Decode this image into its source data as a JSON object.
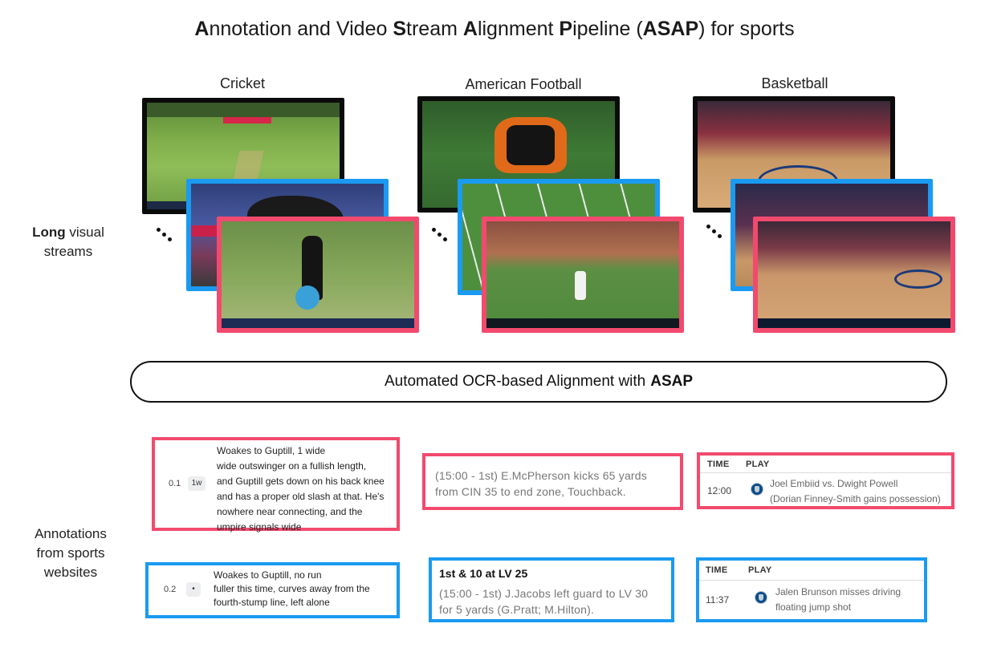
{
  "title": {
    "parts": [
      {
        "text": "A",
        "bold": true
      },
      {
        "text": "nnotation and Video ",
        "bold": false
      },
      {
        "text": "S",
        "bold": true
      },
      {
        "text": "tream ",
        "bold": false
      },
      {
        "text": "A",
        "bold": true
      },
      {
        "text": "lignment ",
        "bold": false
      },
      {
        "text": "P",
        "bold": true
      },
      {
        "text": "ipeline (",
        "bold": false
      },
      {
        "text": "ASAP",
        "bold": true
      },
      {
        "text": ") for sports",
        "bold": false
      }
    ]
  },
  "sports": {
    "cricket": "Cricket",
    "football": "American Football",
    "basketball": "Basketball"
  },
  "side_labels": {
    "streams_bold": "Long",
    "streams_line1_rest": " visual",
    "streams_line2": "streams",
    "annotations_line1": "Annotations",
    "annotations_line2": "from sports",
    "annotations_line3": "websites"
  },
  "banner": {
    "prefix": "Automated OCR-based Alignment with",
    "bold": "ASAP"
  },
  "colors": {
    "pink": "#f24a6e",
    "blue": "#1a9af0",
    "black": "#0b0b0b"
  },
  "annotations": {
    "cricket_pink": {
      "over": "0.1",
      "badge": "1w",
      "lines": [
        "Woakes to Guptill, 1 wide",
        "wide outswinger on a fullish length,",
        "and Guptill gets down on his back knee",
        "and has a proper old slash at that. He's",
        "nowhere near connecting, and the",
        "umpire signals wide"
      ]
    },
    "cricket_blue": {
      "over": "0.2",
      "badge": "•",
      "lines": [
        "Woakes to Guptill, no run",
        "fuller this time, curves away from the",
        "fourth-stump line, left alone"
      ]
    },
    "football_pink": {
      "lines": [
        "(15:00 - 1st) E.McPherson kicks 65 yards",
        "from CIN 35 to end zone, Touchback."
      ]
    },
    "football_blue": {
      "heading": "1st & 10 at LV 25",
      "lines": [
        "(15:00 - 1st) J.Jacobs left guard to LV 30",
        "for 5 yards (G.Pratt; M.Hilton)."
      ]
    },
    "basketball_pink": {
      "col_time": "TIME",
      "col_play": "PLAY",
      "time": "12:00",
      "icon": "mavericks-logo-icon",
      "lines": [
        "Joel Embiid vs. Dwight Powell",
        "(Dorian Finney-Smith gains possession)"
      ]
    },
    "basketball_blue": {
      "col_time": "TIME",
      "col_play": "PLAY",
      "time": "11:37",
      "icon": "mavericks-logo-icon",
      "lines": [
        "Jalen Brunson misses driving",
        "floating jump shot"
      ]
    }
  }
}
